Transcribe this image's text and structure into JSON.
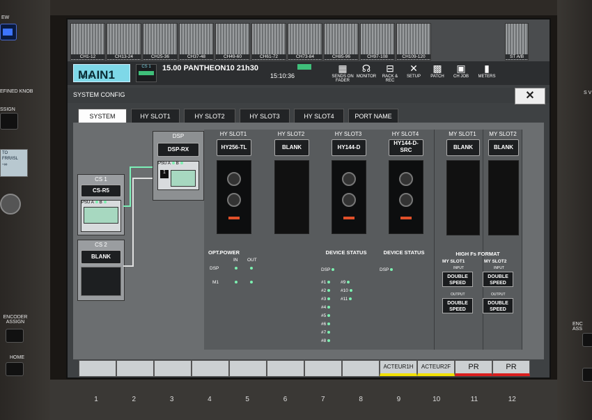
{
  "console": {
    "left_labels": {
      "view": "EW",
      "user_knob": "EFINED KNOB",
      "assign": "SSIGN",
      "display_top": "TO",
      "display_mid": "FRR/ISL",
      "display_val": "-∞",
      "encoder_assign": "ENCODER ASSIGN",
      "home": "HOME"
    },
    "right_labels": {
      "encoder": "ENC ASS",
      "s": "S V"
    },
    "fader_numbers": [
      "1",
      "2",
      "3",
      "4",
      "5",
      "6",
      "7",
      "8",
      "9",
      "10",
      "11",
      "12"
    ]
  },
  "meters": [
    "CH1-12",
    "CH13-24",
    "CH25-36",
    "CH37-48",
    "CH49-60",
    "CH61-72",
    "CH73-84",
    "CH85-96",
    "CH97-108",
    "CH109-120"
  ],
  "stab_label": "ST A/B",
  "toolbar": {
    "ch_number": "CH 51",
    "ch_name": "MAIN1",
    "cs_badge": "CS 1",
    "scene": "15.00  PANTHEON10 21h30",
    "time": "15:10:36",
    "buttons": [
      {
        "label": "SENDS ON FADER",
        "icon": "sends-icon"
      },
      {
        "label": "MONITOR",
        "icon": "headphones-icon"
      },
      {
        "label": "RACK & REC",
        "icon": "rack-icon"
      },
      {
        "label": "SETUP",
        "icon": "tools-icon"
      },
      {
        "label": "PATCH",
        "icon": "grid-icon"
      },
      {
        "label": "CH JOB",
        "icon": "briefcase-icon"
      },
      {
        "label": "METERS",
        "icon": "meters-icon"
      }
    ]
  },
  "window": {
    "title": "SYSTEM CONFIG",
    "close": "✕"
  },
  "tabs": [
    "SYSTEM",
    "HY SLOT1",
    "HY SLOT2",
    "HY SLOT3",
    "HY SLOT4",
    "PORT NAME"
  ],
  "dsp": {
    "title": "DSP",
    "model": "DSP-RX",
    "psu": "PSU",
    "a": "A",
    "b": "B",
    "num": "1"
  },
  "cs1": {
    "title": "CS 1",
    "model": "CS-R5",
    "psu": "PSU",
    "a": "A",
    "b": "B"
  },
  "cs2": {
    "title": "CS 2",
    "model": "BLANK"
  },
  "slots": [
    {
      "title": "HY SLOT1",
      "card": "HY256-TL"
    },
    {
      "title": "HY SLOT2",
      "card": "BLANK"
    },
    {
      "title": "HY SLOT3",
      "card": "HY144-D"
    },
    {
      "title": "HY SLOT4",
      "card": "HY144-D-SRC"
    },
    {
      "title": "MY SLOT1",
      "card": "BLANK"
    },
    {
      "title": "MY SLOT2",
      "card": "BLANK"
    }
  ],
  "opt_power": {
    "title": "OPT.POWER",
    "in": "IN",
    "out": "OUT",
    "rows": [
      "DSP",
      "M1"
    ]
  },
  "device_status3": {
    "title": "DEVICE STATUS",
    "dsp": "DSP",
    "left": [
      "#1",
      "#2",
      "#3",
      "#4",
      "#5",
      "#6",
      "#7",
      "#8"
    ],
    "right": [
      "#9",
      "#10",
      "#11"
    ]
  },
  "device_status4": {
    "title": "DEVICE STATUS",
    "dsp": "DSP"
  },
  "high_fs": {
    "title": "HIGH Fs FORMAT",
    "my1": "MY SLOT1",
    "my2": "MY SLOT2",
    "input": "INPUT",
    "output": "OUTPUT",
    "btn": "DOUBLE SPEED"
  },
  "bottom": [
    "",
    "",
    "",
    "",
    "",
    "",
    "",
    "",
    "ACTEUR1H",
    "ACTEUR2F",
    "PR",
    "PR"
  ]
}
